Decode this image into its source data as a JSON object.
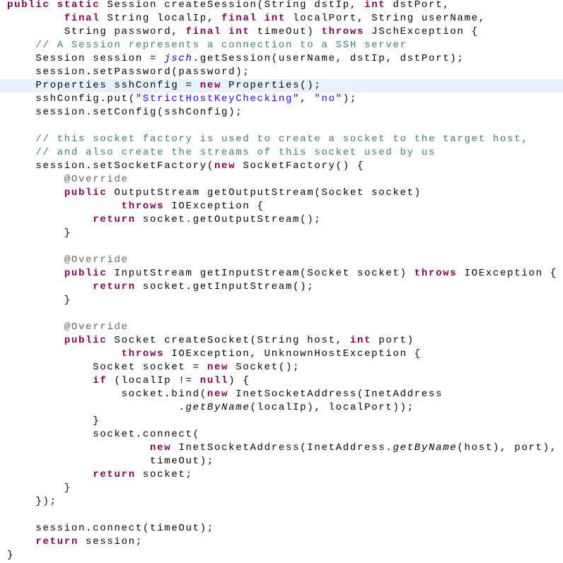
{
  "editor": {
    "language": "java",
    "current_line_index": 6,
    "colors": {
      "keyword": "#7f0055",
      "comment": "#3f7f5f",
      "string": "#2a00ff",
      "annotation": "#646464",
      "field": "#0000c0",
      "plain": "#000000",
      "current_line_bg": "#e8f2fe"
    },
    "lines": [
      [
        [
          "kw",
          "public"
        ],
        [
          "p",
          " "
        ],
        [
          "kw",
          "static"
        ],
        [
          "p",
          " Session createSession(String dstIp, "
        ],
        [
          "kw",
          "int"
        ],
        [
          "p",
          " dstPort,"
        ]
      ],
      [
        [
          "p",
          "        "
        ],
        [
          "kw",
          "final"
        ],
        [
          "p",
          " String localIp, "
        ],
        [
          "kw",
          "final"
        ],
        [
          "p",
          " "
        ],
        [
          "kw",
          "int"
        ],
        [
          "p",
          " localPort, String userName,"
        ]
      ],
      [
        [
          "p",
          "        String password, "
        ],
        [
          "kw",
          "final"
        ],
        [
          "p",
          " "
        ],
        [
          "kw",
          "int"
        ],
        [
          "p",
          " timeOut) "
        ],
        [
          "kw",
          "throws"
        ],
        [
          "p",
          " JSchException {"
        ]
      ],
      [
        [
          "p",
          "    "
        ],
        [
          "cm",
          "// A Session represents a connection to a SSH server"
        ]
      ],
      [
        [
          "p",
          "    Session session = "
        ],
        [
          "field",
          "jsch"
        ],
        [
          "p",
          ".getSession(userName, dstIp, dstPort);"
        ]
      ],
      [
        [
          "p",
          "    session.setPassword(password);"
        ]
      ],
      [
        [
          "p",
          "    Properties sshConfig = "
        ],
        [
          "kw",
          "new"
        ],
        [
          "p",
          " Properties();"
        ]
      ],
      [
        [
          "p",
          "    sshConfig.put("
        ],
        [
          "str",
          "\"StrictHostKeyChecking\""
        ],
        [
          "p",
          ", "
        ],
        [
          "str",
          "\"no\""
        ],
        [
          "p",
          ");"
        ]
      ],
      [
        [
          "p",
          "    session.setConfig(sshConfig);"
        ]
      ],
      [
        [
          "p",
          ""
        ]
      ],
      [
        [
          "p",
          "    "
        ],
        [
          "cm",
          "// this socket factory is used to create a socket to the target host,"
        ]
      ],
      [
        [
          "p",
          "    "
        ],
        [
          "cm",
          "// and also create the streams of this socket used by us"
        ]
      ],
      [
        [
          "p",
          "    session.setSocketFactory("
        ],
        [
          "kw",
          "new"
        ],
        [
          "p",
          " SocketFactory() {"
        ]
      ],
      [
        [
          "p",
          "        "
        ],
        [
          "ann",
          "@Override"
        ]
      ],
      [
        [
          "p",
          "        "
        ],
        [
          "kw",
          "public"
        ],
        [
          "p",
          " OutputStream getOutputStream(Socket socket)"
        ]
      ],
      [
        [
          "p",
          "                "
        ],
        [
          "kw",
          "throws"
        ],
        [
          "p",
          " IOException {"
        ]
      ],
      [
        [
          "p",
          "            "
        ],
        [
          "kw",
          "return"
        ],
        [
          "p",
          " socket.getOutputStream();"
        ]
      ],
      [
        [
          "p",
          "        }"
        ]
      ],
      [
        [
          "p",
          ""
        ]
      ],
      [
        [
          "p",
          "        "
        ],
        [
          "ann",
          "@Override"
        ]
      ],
      [
        [
          "p",
          "        "
        ],
        [
          "kw",
          "public"
        ],
        [
          "p",
          " InputStream getInputStream(Socket socket) "
        ],
        [
          "kw",
          "throws"
        ],
        [
          "p",
          " IOException {"
        ]
      ],
      [
        [
          "p",
          "            "
        ],
        [
          "kw",
          "return"
        ],
        [
          "p",
          " socket.getInputStream();"
        ]
      ],
      [
        [
          "p",
          "        }"
        ]
      ],
      [
        [
          "p",
          ""
        ]
      ],
      [
        [
          "p",
          "        "
        ],
        [
          "ann",
          "@Override"
        ]
      ],
      [
        [
          "p",
          "        "
        ],
        [
          "kw",
          "public"
        ],
        [
          "p",
          " Socket createSocket(String host, "
        ],
        [
          "kw",
          "int"
        ],
        [
          "p",
          " port)"
        ]
      ],
      [
        [
          "p",
          "                "
        ],
        [
          "kw",
          "throws"
        ],
        [
          "p",
          " IOException, UnknownHostException {"
        ]
      ],
      [
        [
          "p",
          "            Socket socket = "
        ],
        [
          "kw",
          "new"
        ],
        [
          "p",
          " Socket();"
        ]
      ],
      [
        [
          "p",
          "            "
        ],
        [
          "kw",
          "if"
        ],
        [
          "p",
          " (localIp != "
        ],
        [
          "kw",
          "null"
        ],
        [
          "p",
          ") {"
        ]
      ],
      [
        [
          "p",
          "                socket.bind("
        ],
        [
          "kw",
          "new"
        ],
        [
          "p",
          " InetSocketAddress(InetAddress"
        ]
      ],
      [
        [
          "p",
          "                        ."
        ],
        [
          "static",
          "getByName"
        ],
        [
          "p",
          "(localIp), localPort));"
        ]
      ],
      [
        [
          "p",
          "            }"
        ]
      ],
      [
        [
          "p",
          "            socket.connect("
        ]
      ],
      [
        [
          "p",
          "                    "
        ],
        [
          "kw",
          "new"
        ],
        [
          "p",
          " InetSocketAddress(InetAddress."
        ],
        [
          "static",
          "getByName"
        ],
        [
          "p",
          "(host), port),"
        ]
      ],
      [
        [
          "p",
          "                    timeOut);"
        ]
      ],
      [
        [
          "p",
          "            "
        ],
        [
          "kw",
          "return"
        ],
        [
          "p",
          " socket;"
        ]
      ],
      [
        [
          "p",
          "        }"
        ]
      ],
      [
        [
          "p",
          "    });"
        ]
      ],
      [
        [
          "p",
          ""
        ]
      ],
      [
        [
          "p",
          "    session.connect(timeOut);"
        ]
      ],
      [
        [
          "p",
          "    "
        ],
        [
          "kw",
          "return"
        ],
        [
          "p",
          " session;"
        ]
      ],
      [
        [
          "p",
          "}"
        ]
      ]
    ]
  }
}
